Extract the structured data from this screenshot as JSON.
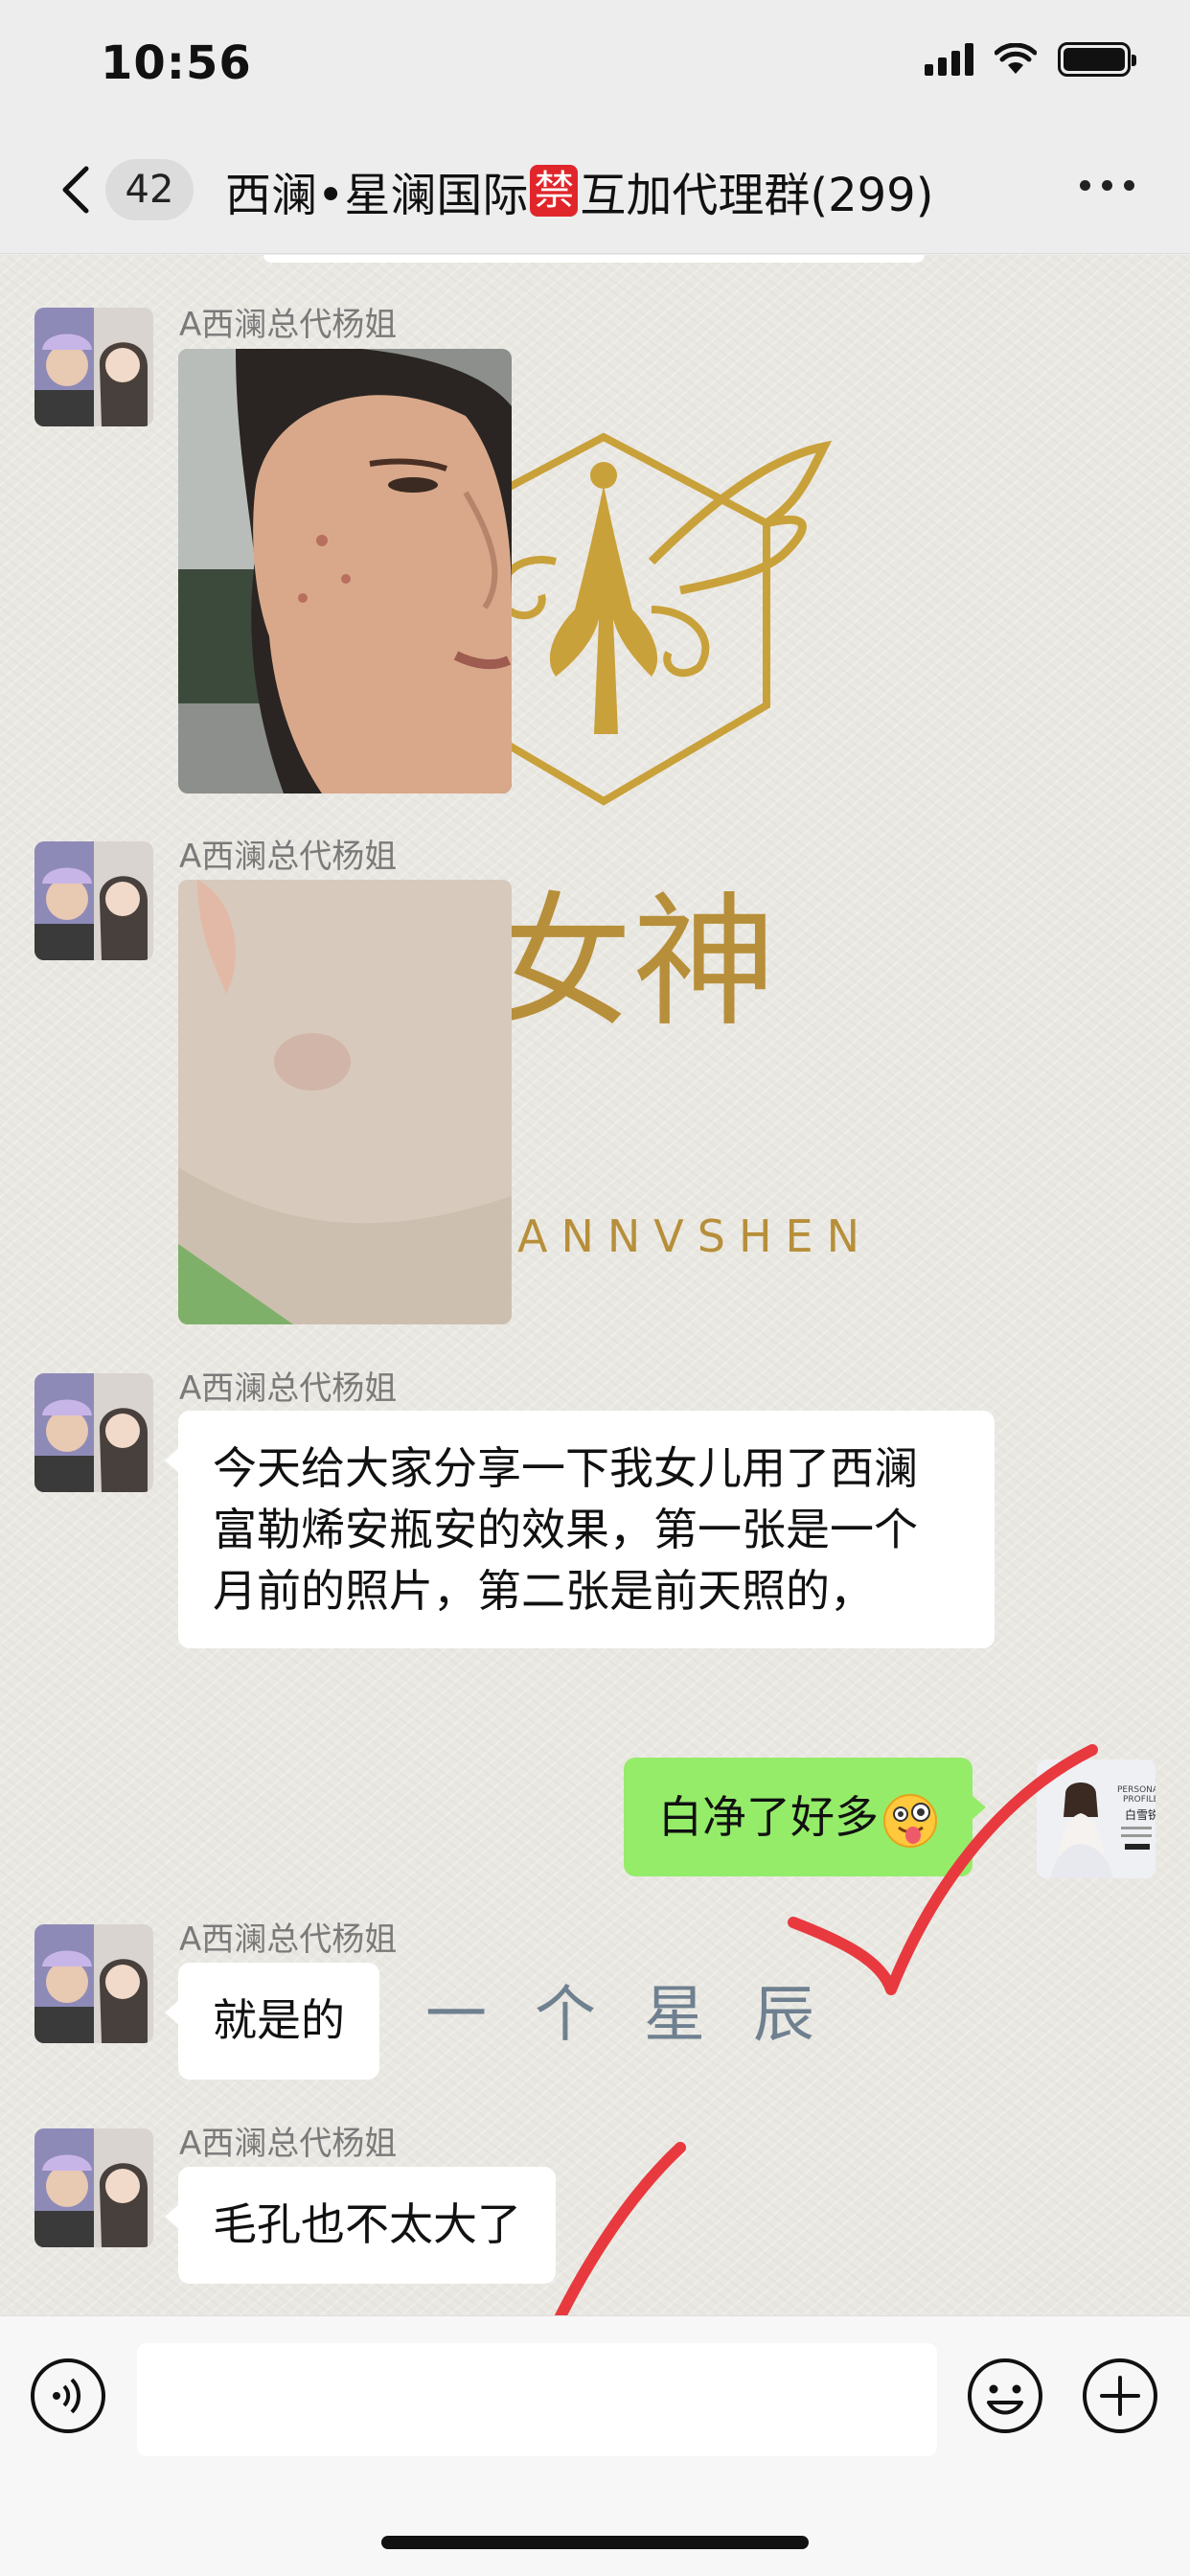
{
  "status_bar": {
    "time": "10:56"
  },
  "nav": {
    "unread_count": "42",
    "title_prefix": "西澜•星澜国际",
    "title_badge": "禁",
    "title_suffix": "互加代理群(299)"
  },
  "wallpaper": {
    "brand_latin": "ANNVSHEN",
    "brand_chinese": "女神",
    "script_text": "下一个星辰"
  },
  "messages": [
    {
      "sender": "A西澜总代杨姐",
      "type": "image",
      "description_icon": "face-photo"
    },
    {
      "sender": "A西澜总代杨姐",
      "type": "image",
      "description_icon": "cheek-photo"
    },
    {
      "sender": "A西澜总代杨姐",
      "type": "text",
      "text": "今天给大家分享一下我女儿用了西澜富勒烯安瓶安的效果，第一张是一个月前的照片，第二张是前天照的，"
    },
    {
      "sender": "",
      "type": "text",
      "mine": true,
      "text": "白净了好多",
      "emoji": "face-with-tongue"
    },
    {
      "sender": "A西澜总代杨姐",
      "type": "text",
      "text": "就是的"
    },
    {
      "sender": "A西澜总代杨姐",
      "type": "text",
      "text": "毛孔也不太大了"
    }
  ],
  "my_avatar": {
    "card_line1": "PERSONAL",
    "card_line2": "PROFILE",
    "card_name": "白雪锐"
  },
  "input_bar": {
    "placeholder": ""
  },
  "colors": {
    "my_bubble": "#95ec69",
    "ban_badge": "#e0262b",
    "check_mark": "#e8393f"
  }
}
